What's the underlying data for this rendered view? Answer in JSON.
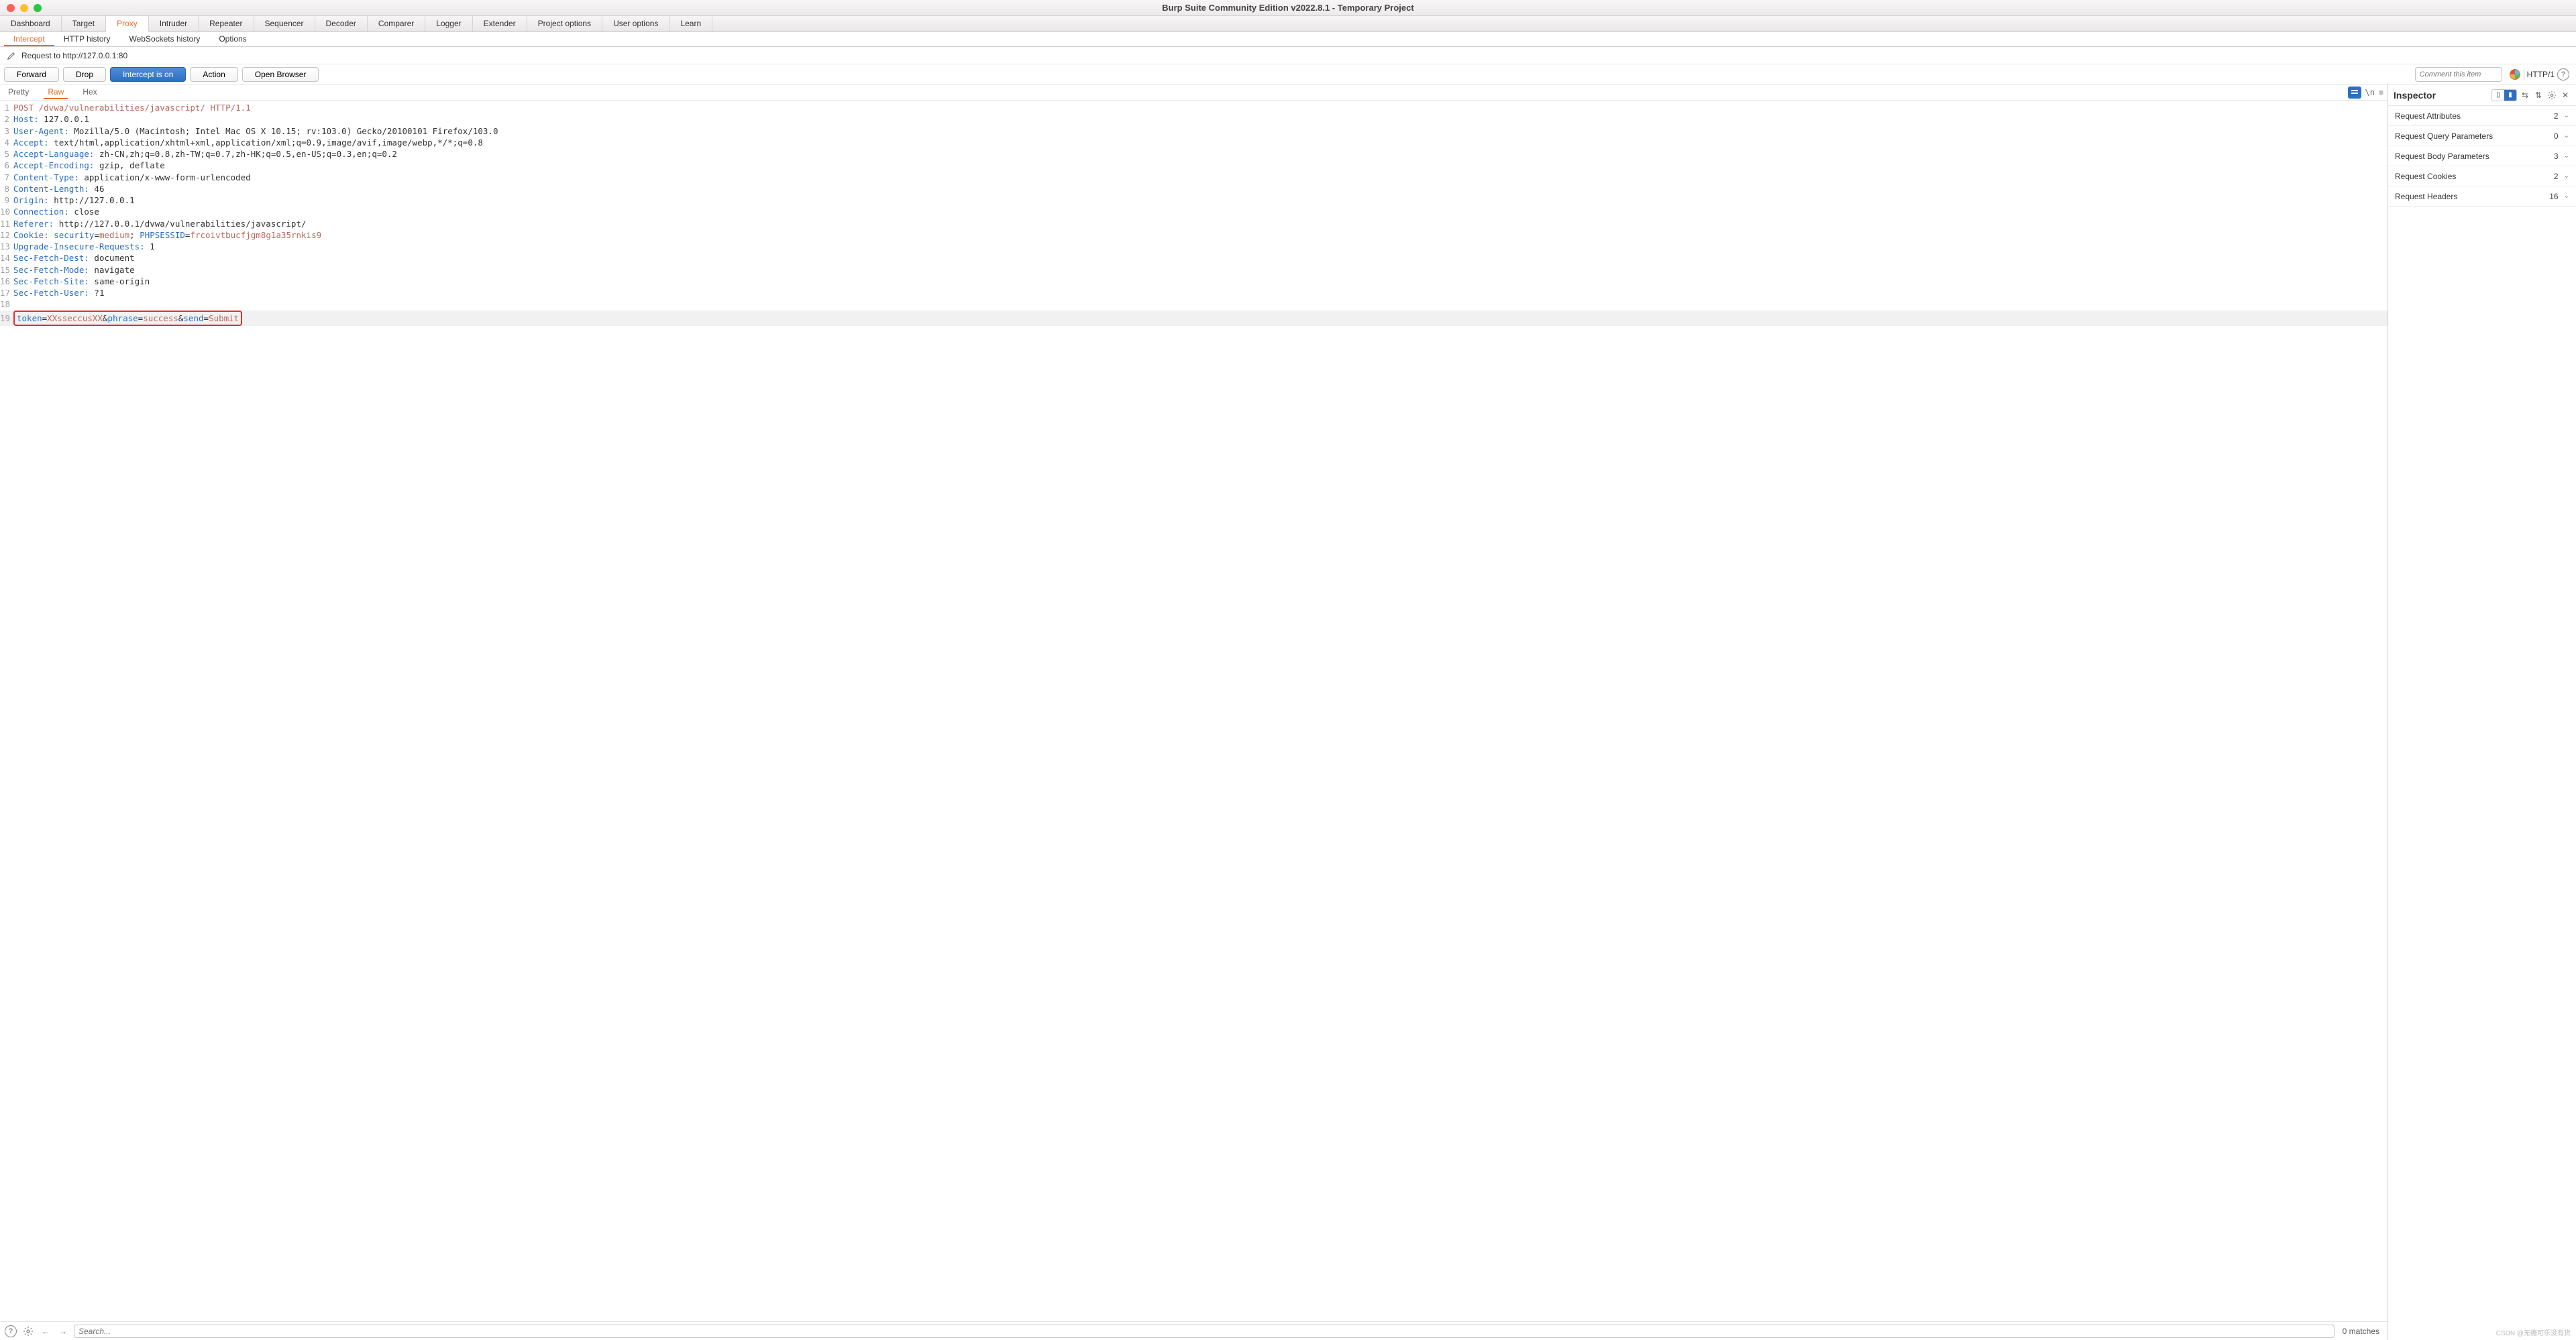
{
  "window": {
    "title": "Burp Suite Community Edition v2022.8.1 - Temporary Project"
  },
  "mainTabs": [
    "Dashboard",
    "Target",
    "Proxy",
    "Intruder",
    "Repeater",
    "Sequencer",
    "Decoder",
    "Comparer",
    "Logger",
    "Extender",
    "Project options",
    "User options",
    "Learn"
  ],
  "activeMainTab": "Proxy",
  "subTabs": [
    "Intercept",
    "HTTP history",
    "WebSockets history",
    "Options"
  ],
  "activeSubTab": "Intercept",
  "requestLine": "Request to http://127.0.0.1:80",
  "actions": {
    "forward": "Forward",
    "drop": "Drop",
    "intercept": "Intercept is on",
    "action": "Action",
    "open": "Open Browser",
    "commentPlaceholder": "Comment this item",
    "httpVersion": "HTTP/1"
  },
  "viewTabs": [
    "Pretty",
    "Raw",
    "Hex"
  ],
  "activeViewTab": "Raw",
  "http": {
    "lines": [
      {
        "n": 1,
        "segs": [
          {
            "t": "POST /dvwa/vulnerabilities/javascript/ HTTP/1.1",
            "c": "hm"
          }
        ]
      },
      {
        "n": 2,
        "segs": [
          {
            "t": "Host:",
            "c": "hk"
          },
          {
            "t": " 127.0.0.1"
          }
        ]
      },
      {
        "n": 3,
        "segs": [
          {
            "t": "User-Agent:",
            "c": "hk"
          },
          {
            "t": " Mozilla/5.0 (Macintosh; Intel Mac OS X 10.15; rv:103.0) Gecko/20100101 Firefox/103.0"
          }
        ]
      },
      {
        "n": 4,
        "segs": [
          {
            "t": "Accept:",
            "c": "hk"
          },
          {
            "t": " text/html,application/xhtml+xml,application/xml;q=0.9,image/avif,image/webp,*/*;q=0.8"
          }
        ]
      },
      {
        "n": 5,
        "segs": [
          {
            "t": "Accept-Language:",
            "c": "hk"
          },
          {
            "t": " zh-CN,zh;q=0.8,zh-TW;q=0.7,zh-HK;q=0.5,en-US;q=0.3,en;q=0.2"
          }
        ]
      },
      {
        "n": 6,
        "segs": [
          {
            "t": "Accept-Encoding:",
            "c": "hk"
          },
          {
            "t": " gzip, deflate"
          }
        ]
      },
      {
        "n": 7,
        "segs": [
          {
            "t": "Content-Type:",
            "c": "hk"
          },
          {
            "t": " application/x-www-form-urlencoded"
          }
        ]
      },
      {
        "n": 8,
        "segs": [
          {
            "t": "Content-Length:",
            "c": "hk"
          },
          {
            "t": " 46"
          }
        ]
      },
      {
        "n": 9,
        "segs": [
          {
            "t": "Origin:",
            "c": "hk"
          },
          {
            "t": " http://127.0.0.1"
          }
        ]
      },
      {
        "n": 10,
        "segs": [
          {
            "t": "Connection:",
            "c": "hk"
          },
          {
            "t": " close"
          }
        ]
      },
      {
        "n": 11,
        "segs": [
          {
            "t": "Referer:",
            "c": "hk"
          },
          {
            "t": " http://127.0.0.1/dvwa/vulnerabilities/javascript/"
          }
        ]
      },
      {
        "n": 12,
        "segs": [
          {
            "t": "Cookie:",
            "c": "hk"
          },
          {
            "t": " "
          },
          {
            "t": "security",
            "c": "hk"
          },
          {
            "t": "="
          },
          {
            "t": "medium",
            "c": "hv2"
          },
          {
            "t": "; "
          },
          {
            "t": "PHPSESSID",
            "c": "hk"
          },
          {
            "t": "="
          },
          {
            "t": "frcoivtbucfjgm8g1a35rnkis9",
            "c": "hv2"
          }
        ]
      },
      {
        "n": 13,
        "segs": [
          {
            "t": "Upgrade-Insecure-Requests:",
            "c": "hk"
          },
          {
            "t": " 1"
          }
        ]
      },
      {
        "n": 14,
        "segs": [
          {
            "t": "Sec-Fetch-Dest:",
            "c": "hk"
          },
          {
            "t": " document"
          }
        ]
      },
      {
        "n": 15,
        "segs": [
          {
            "t": "Sec-Fetch-Mode:",
            "c": "hk"
          },
          {
            "t": " navigate"
          }
        ]
      },
      {
        "n": 16,
        "segs": [
          {
            "t": "Sec-Fetch-Site:",
            "c": "hk"
          },
          {
            "t": " same-origin"
          }
        ]
      },
      {
        "n": 17,
        "segs": [
          {
            "t": "Sec-Fetch-User:",
            "c": "hk"
          },
          {
            "t": " ?1"
          }
        ]
      },
      {
        "n": 18,
        "segs": [
          {
            "t": ""
          }
        ]
      },
      {
        "n": 19,
        "hl": true,
        "box": true,
        "segs": [
          {
            "t": "token",
            "c": "hk"
          },
          {
            "t": "="
          },
          {
            "t": "XXsseccusXX",
            "c": "hv2"
          },
          {
            "t": "&"
          },
          {
            "t": "phrase",
            "c": "hk"
          },
          {
            "t": "="
          },
          {
            "t": "success",
            "c": "hv2"
          },
          {
            "t": "&"
          },
          {
            "t": "send",
            "c": "hk"
          },
          {
            "t": "="
          },
          {
            "t": "Submit",
            "c": "hv2"
          }
        ]
      }
    ]
  },
  "search": {
    "placeholder": "Search...",
    "matches": "0 matches"
  },
  "inspector": {
    "title": "Inspector",
    "sections": [
      {
        "label": "Request Attributes",
        "count": 2
      },
      {
        "label": "Request Query Parameters",
        "count": 0
      },
      {
        "label": "Request Body Parameters",
        "count": 3
      },
      {
        "label": "Request Cookies",
        "count": 2
      },
      {
        "label": "Request Headers",
        "count": 16
      }
    ]
  },
  "watermark": "CSDN @无糖可乐没有货"
}
